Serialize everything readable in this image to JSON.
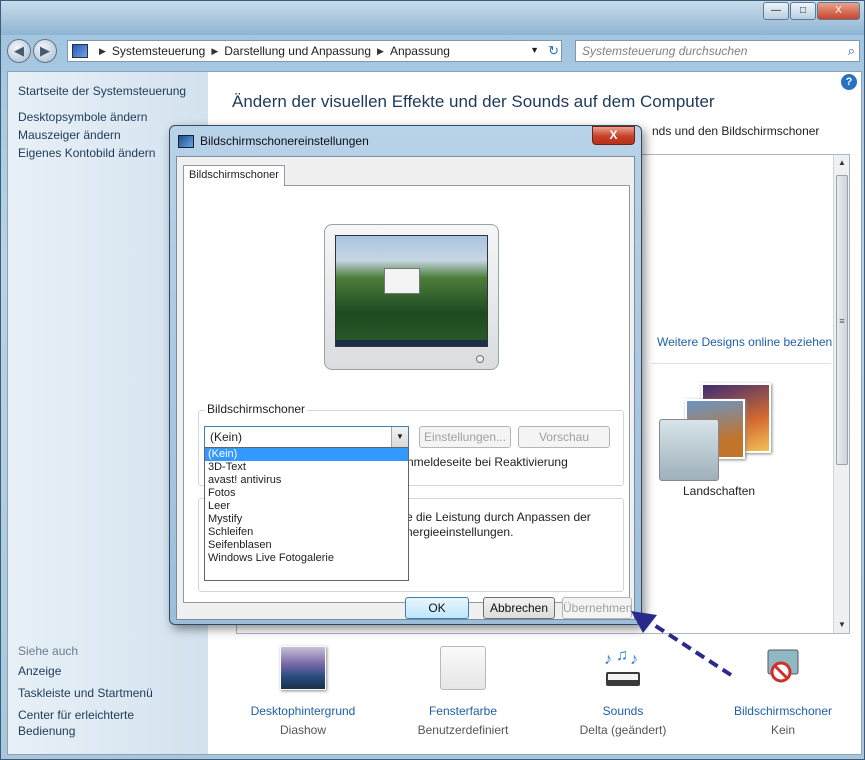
{
  "window": {
    "controls": {
      "minimize": "—",
      "maximize": "□",
      "close": "X"
    },
    "address": {
      "crumbs": [
        "Systemsteuerung",
        "Darstellung und Anpassung",
        "Anpassung"
      ],
      "separator": "▶",
      "dropdown": "▼",
      "refresh": "↻"
    },
    "search": {
      "placeholder": "Systemsteuerung durchsuchen",
      "icon": "⌕"
    },
    "help": "?"
  },
  "sidebar": {
    "links": [
      "Startseite der Systemsteuerung",
      "Desktopsymbole ändern",
      "Mauszeiger ändern",
      "Eigenes Kontobild ändern"
    ],
    "see_also": "Siehe auch",
    "see_also_links": [
      "Anzeige",
      "Taskleiste und Startmenü",
      "Center für erleichterte",
      "Bedienung"
    ]
  },
  "main": {
    "title": "Ändern der visuellen Effekte und der Sounds auf dem Computer",
    "subtitle_visible": "nds und den Bildschirmschoner",
    "online_link": "Weitere Designs online beziehen",
    "theme_label": "Landschaften",
    "scroll_up": "▲",
    "scroll_down": "▼",
    "scroll_grip": "≡"
  },
  "bottom_items": [
    {
      "title": "Desktophintergrund",
      "sub": "Diashow"
    },
    {
      "title": "Fensterfarbe",
      "sub": "Benutzerdefiniert"
    },
    {
      "title": "Sounds",
      "sub": "Delta (geändert)"
    },
    {
      "title": "Bildschirmschoner",
      "sub": "Kein"
    }
  ],
  "dialog": {
    "title": "Bildschirmschonereinstellungen",
    "close": "X",
    "tab": "Bildschirmschoner",
    "group_label": "Bildschirmschoner",
    "selected": "(Kein)",
    "combo_arrow": "▼",
    "settings_btn": "Einstellungen...",
    "preview_btn": "Vorschau",
    "checkbox_text": "nmeldeseite bei Reaktivierung",
    "group2_label": "",
    "power_line1": "e die Leistung durch Anpassen der",
    "power_line2": "nergieeinstellungen.",
    "options": [
      "(Kein)",
      "3D-Text",
      "avast! antivirus",
      "Fotos",
      "Leer",
      "Mystify",
      "Schleifen",
      "Seifenblasen",
      "Windows Live Fotogalerie"
    ],
    "ok": "OK",
    "cancel": "Abbrechen",
    "apply": "Übernehmen"
  },
  "colors": {
    "accent": "#3399ff",
    "link": "#1f5fa8",
    "arrow": "#2a2a8c"
  }
}
